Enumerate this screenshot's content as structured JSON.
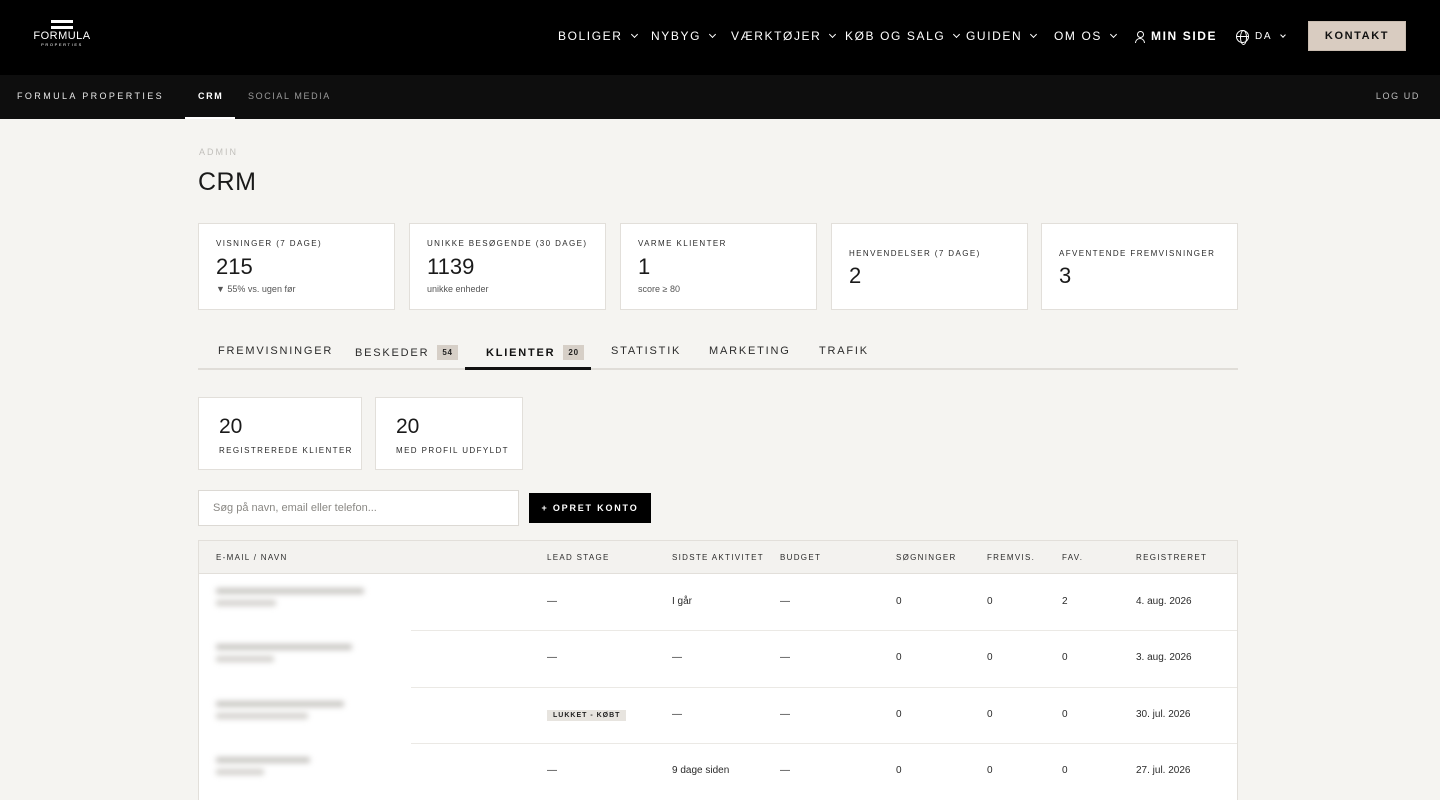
{
  "brand": {
    "logo_word": "FORMULA",
    "logo_sub": "PROPERTIES"
  },
  "topnav": {
    "items": [
      {
        "label": "BOLIGER",
        "icon": "chevron-down-icon"
      },
      {
        "label": "NYBYG",
        "icon": "chevron-down-icon"
      },
      {
        "label": "VÆRKTØJER",
        "icon": "chevron-down-icon"
      },
      {
        "label": "KØB OG SALG",
        "icon": "chevron-down-icon"
      },
      {
        "label": "GUIDEN",
        "icon": "chevron-down-icon"
      },
      {
        "label": "OM OS",
        "icon": "chevron-down-icon"
      }
    ],
    "min_side": "MIN SIDE",
    "language": "DA",
    "contact_button": "KONTAKT"
  },
  "subnav": {
    "brand": "FORMULA PROPERTIES",
    "tabs": [
      {
        "label": "CRM",
        "active": true
      },
      {
        "label": "SOCIAL MEDIA",
        "active": false
      }
    ],
    "logout": "LOG UD"
  },
  "header": {
    "breadcrumb": "ADMIN",
    "title": "CRM"
  },
  "kpis": [
    {
      "label": "VISNINGER (7 DAGE)",
      "value": "215",
      "note": "▼ 55% vs. ugen før"
    },
    {
      "label": "UNIKKE BESØGENDE (30 DAGE)",
      "value": "1139",
      "note": "unikke enheder"
    },
    {
      "label": "VARME KLIENTER",
      "value": "1",
      "note": "score ≥ 80"
    },
    {
      "label": "HENVENDELSER (7 DAGE)",
      "value": "2",
      "note": ""
    },
    {
      "label": "AFVENTENDE FREMVISNINGER",
      "value": "3",
      "note": ""
    }
  ],
  "tabs": [
    {
      "label": "FREMVISNINGER",
      "badge": ""
    },
    {
      "label": "BESKEDER",
      "badge": "54"
    },
    {
      "label": "KLIENTER",
      "badge": "20",
      "active": true
    },
    {
      "label": "STATISTIK",
      "badge": ""
    },
    {
      "label": "MARKETING",
      "badge": ""
    },
    {
      "label": "TRAFIK",
      "badge": ""
    }
  ],
  "summary": [
    {
      "value": "20",
      "label": "REGISTREREDE KLIENTER"
    },
    {
      "value": "20",
      "label": "MED PROFIL UDFYLDT"
    }
  ],
  "search": {
    "placeholder": "Søg på navn, email eller telefon..."
  },
  "create_button": "+ OPRET KONTO",
  "table": {
    "columns": [
      "E-MAIL / NAVN",
      "LEAD STAGE",
      "SIDSTE AKTIVITET",
      "BUDGET",
      "SØGNINGER",
      "FREMVIS.",
      "FAV.",
      "REGISTRERET"
    ],
    "rows": [
      {
        "lead_stage": "—",
        "lead_badge": "",
        "last_activity": "I går",
        "budget": "—",
        "searches": "0",
        "showings": "0",
        "favs": "2",
        "registered": "4. aug. 2026"
      },
      {
        "lead_stage": "—",
        "lead_badge": "",
        "last_activity": "—",
        "budget": "—",
        "searches": "0",
        "showings": "0",
        "favs": "0",
        "registered": "3. aug. 2026"
      },
      {
        "lead_stage": "",
        "lead_badge": "LUKKET - KØBT",
        "last_activity": "—",
        "budget": "—",
        "searches": "0",
        "showings": "0",
        "favs": "0",
        "registered": "30. jul. 2026"
      },
      {
        "lead_stage": "—",
        "lead_badge": "",
        "last_activity": "9 dage siden",
        "budget": "—",
        "searches": "0",
        "showings": "0",
        "favs": "0",
        "registered": "27. jul. 2026"
      }
    ]
  }
}
